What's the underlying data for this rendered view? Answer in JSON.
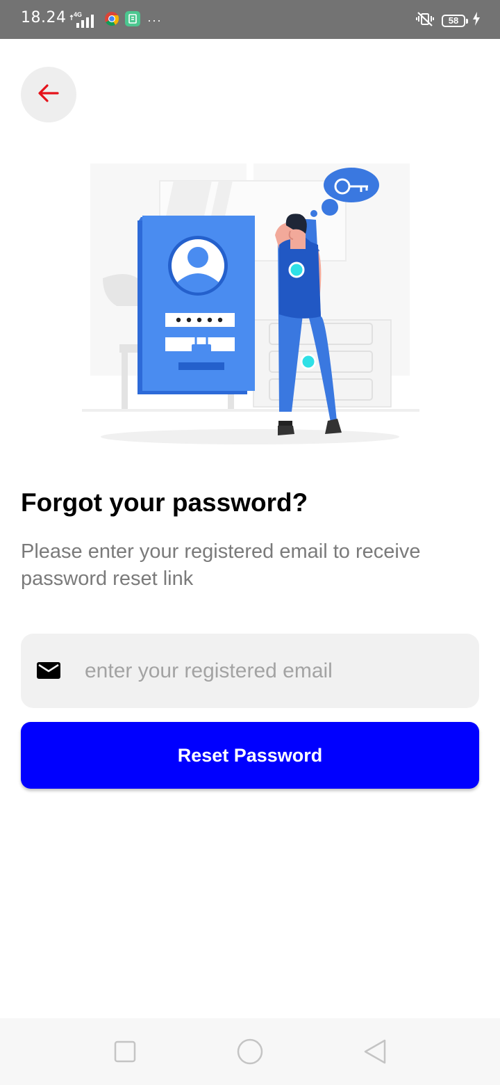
{
  "status_bar": {
    "time": "18.24",
    "network_label": "4G",
    "battery_level": "58",
    "overflow": "···",
    "icons": [
      "signal-icon",
      "chrome-icon",
      "app-notification-icon",
      "vibrate-off-icon",
      "battery-icon",
      "charging-icon"
    ]
  },
  "header": {
    "back_icon": "arrow-left-icon",
    "back_icon_color": "#e5121a"
  },
  "content": {
    "title": "Forgot your password?",
    "subtitle": "Please enter your registered email to receive password reset link"
  },
  "email_field": {
    "icon": "mail-icon",
    "value": "",
    "placeholder": "enter your registered email"
  },
  "reset_button": {
    "label": "Reset Password",
    "color": "#0000ff"
  },
  "nav_bar": {
    "icons": [
      "recents-square-icon",
      "home-circle-icon",
      "back-triangle-icon"
    ]
  }
}
